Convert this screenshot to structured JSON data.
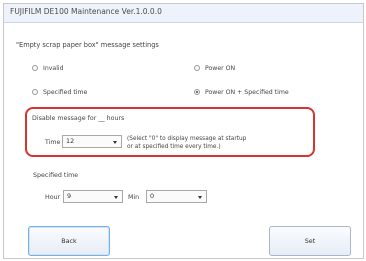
{
  "window": {
    "title": "FUJIFILM DE100 Maintenance Ver.1.0.0.0"
  },
  "section": {
    "title": "\"Empty scrap paper box\" message settings"
  },
  "radios": [
    {
      "label": "Invalid",
      "checked": false
    },
    {
      "label": "Power ON",
      "checked": false
    },
    {
      "label": "Specified time",
      "checked": false
    },
    {
      "label": "Power ON + Specified time",
      "checked": true
    }
  ],
  "disable": {
    "label": "Disable message for __ hours",
    "time_label": "Time",
    "time_value": "12",
    "note_line1": "(Select \"0\" to display message at startup",
    "note_line2": "or at specified time every time.)"
  },
  "specified": {
    "title": "Specified time",
    "hour_label": "Hour",
    "hour_value": "9",
    "min_label": "Min",
    "min_value": "0"
  },
  "buttons": {
    "back": "Back",
    "set": "Set"
  },
  "colors": {
    "highlight": "#d8342f",
    "titlebar": "#eef3fb"
  }
}
